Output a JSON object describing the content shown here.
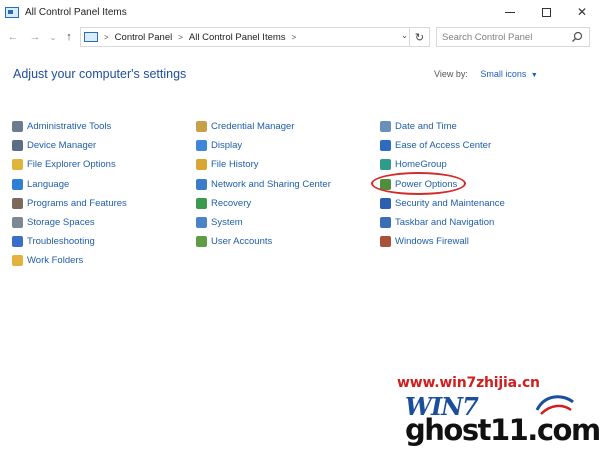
{
  "window": {
    "title": "All Control Panel Items",
    "controls": {
      "minimize": "",
      "maximize": "",
      "close": "✕"
    }
  },
  "navbar": {
    "back": "←",
    "forward": "→",
    "recent": "⌄",
    "up": "↑",
    "breadcrumb": [
      "Control Panel",
      "All Control Panel Items"
    ],
    "dropdown": "⌄",
    "refresh": "↻",
    "search_placeholder": "Search Control Panel"
  },
  "header": {
    "title": "Adjust your computer's settings",
    "view_by_label": "View by:",
    "view_by_value": "Small icons",
    "view_by_caret": "▼"
  },
  "items": {
    "col1": [
      {
        "label": "Administrative Tools",
        "icon": "tools-icon",
        "color": "#6b7c8f"
      },
      {
        "label": "Device Manager",
        "icon": "device-manager-icon",
        "color": "#5a6e85"
      },
      {
        "label": "File Explorer Options",
        "icon": "folder-options-icon",
        "color": "#e1b53b"
      },
      {
        "label": "Language",
        "icon": "language-icon",
        "color": "#2f7fd6"
      },
      {
        "label": "Programs and Features",
        "icon": "programs-icon",
        "color": "#7b6a5c"
      },
      {
        "label": "Storage Spaces",
        "icon": "storage-icon",
        "color": "#7e8894"
      },
      {
        "label": "Troubleshooting",
        "icon": "troubleshooting-icon",
        "color": "#3a6ec9"
      },
      {
        "label": "Work Folders",
        "icon": "work-folders-icon",
        "color": "#e3b23f"
      }
    ],
    "col2": [
      {
        "label": "Credential Manager",
        "icon": "credential-icon",
        "color": "#c9a04a"
      },
      {
        "label": "Display",
        "icon": "display-icon",
        "color": "#3f86d8"
      },
      {
        "label": "File History",
        "icon": "file-history-icon",
        "color": "#d9a634"
      },
      {
        "label": "Network and Sharing Center",
        "icon": "network-icon",
        "color": "#3b7cc9"
      },
      {
        "label": "Recovery",
        "icon": "recovery-icon",
        "color": "#3c9a4e"
      },
      {
        "label": "System",
        "icon": "system-icon",
        "color": "#4b83c9"
      },
      {
        "label": "User Accounts",
        "icon": "user-accounts-icon",
        "color": "#5f9c46"
      }
    ],
    "col3": [
      {
        "label": "Date and Time",
        "icon": "clock-icon",
        "color": "#6a8fb8"
      },
      {
        "label": "Ease of Access Center",
        "icon": "ease-of-access-icon",
        "color": "#2d6bc1"
      },
      {
        "label": "HomeGroup",
        "icon": "homegroup-icon",
        "color": "#2e9c8a"
      },
      {
        "label": "Power Options",
        "icon": "power-options-icon",
        "color": "#4d8f3a"
      },
      {
        "label": "Security and Maintenance",
        "icon": "flag-icon",
        "color": "#2c5fb0"
      },
      {
        "label": "Taskbar and Navigation",
        "icon": "taskbar-icon",
        "color": "#3a6fb8"
      },
      {
        "label": "Windows Firewall",
        "icon": "firewall-icon",
        "color": "#a8523a"
      }
    ]
  },
  "watermark": {
    "url": "www.win7zhijia.cn",
    "logo": "WIN7",
    "brand": "ghost11.com"
  },
  "colors": {
    "link": "#1f5ea8",
    "heading": "#1f4ea0",
    "highlight": "#d42a2a"
  }
}
